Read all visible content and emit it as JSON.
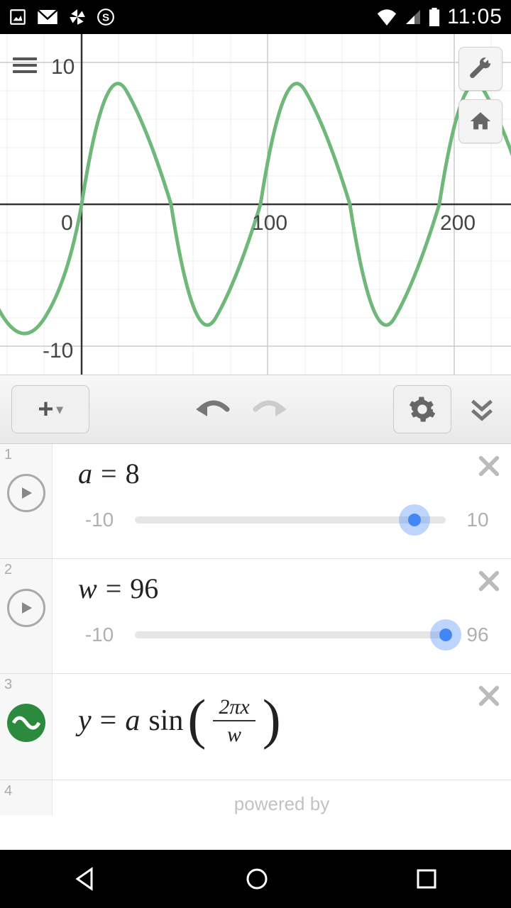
{
  "status": {
    "time": "11:05"
  },
  "chart_data": {
    "type": "line",
    "function": "y = a * sin(2*pi*x / w)",
    "params": {
      "a": 8,
      "w": 96
    },
    "xlim": [
      -40,
      230
    ],
    "ylim": [
      -13,
      13
    ],
    "x_ticks": [
      0,
      100,
      200
    ],
    "y_ticks": [
      -10,
      10
    ],
    "grid": true,
    "xlabel": "",
    "ylabel": "",
    "title": ""
  },
  "graph": {
    "y_top_label": "10",
    "y_bot_label": "-10",
    "x0_label": "0",
    "x100_label": "100",
    "x200_label": "200"
  },
  "rows": [
    {
      "idx": "1",
      "var": "a",
      "eq": "=",
      "value": "8",
      "slider": {
        "min_label": "-10",
        "max_label": "10",
        "min": -10,
        "max": 10,
        "value": 8
      }
    },
    {
      "idx": "2",
      "var": "w",
      "eq": "=",
      "value": "96",
      "slider": {
        "min_label": "-10",
        "max_label": "96",
        "min": -10,
        "max": 96,
        "value": 96
      }
    },
    {
      "idx": "3",
      "formula": {
        "y": "y",
        "eq": "=",
        "a": "a",
        "sin": "sin",
        "frac_top": "2πx",
        "frac_bot": "w"
      }
    },
    {
      "idx": "4",
      "powered": "powered by"
    }
  ]
}
